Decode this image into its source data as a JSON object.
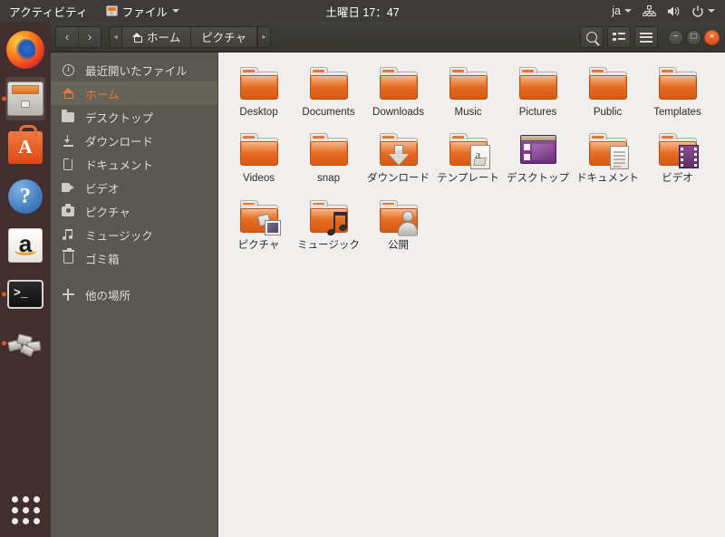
{
  "topbar": {
    "activities": "アクティビティ",
    "app_icon": "files-icon",
    "app_name": "ファイル",
    "app_caret": "chevron-down-icon",
    "clock": "土曜日 17：47",
    "language": "ja",
    "icons": [
      "network-icon",
      "volume-icon",
      "power-icon",
      "chevron-down-icon"
    ]
  },
  "launcher": {
    "items": [
      {
        "name": "firefox",
        "running": false,
        "focused": false
      },
      {
        "name": "files",
        "running": true,
        "focused": true
      },
      {
        "name": "ubuntu-software",
        "running": false,
        "focused": false
      },
      {
        "name": "help",
        "running": false,
        "focused": false
      },
      {
        "name": "amazon",
        "running": false,
        "focused": false
      },
      {
        "name": "terminal",
        "running": true,
        "focused": false
      },
      {
        "name": "misc-app",
        "running": true,
        "focused": false
      }
    ],
    "show_apps": "show-applications"
  },
  "window": {
    "nav": {
      "back": "‹",
      "forward": "›"
    },
    "pathbar": {
      "left_arrow": "◂",
      "right_arrow": "▸",
      "segments": [
        {
          "label": "ホーム",
          "icon": "home-icon",
          "active": false
        },
        {
          "label": "ピクチャ",
          "icon": "",
          "active": true
        }
      ]
    },
    "actions": [
      {
        "name": "search-button",
        "icon": "search-icon"
      },
      {
        "name": "view-toggle-button",
        "icon": "list-view-icon"
      },
      {
        "name": "menu-button",
        "icon": "hamburger-icon"
      }
    ],
    "controls": [
      {
        "name": "minimize-button",
        "glyph": "−"
      },
      {
        "name": "maximize-button",
        "glyph": "□"
      },
      {
        "name": "close-button",
        "glyph": "×"
      }
    ]
  },
  "sidebar": {
    "items": [
      {
        "label": "最近開いたファイル",
        "icon": "clock-icon",
        "selected": false
      },
      {
        "label": "ホーム",
        "icon": "home-icon",
        "selected": true
      },
      {
        "label": "デスクトップ",
        "icon": "folder-icon",
        "selected": false
      },
      {
        "label": "ダウンロード",
        "icon": "download-icon",
        "selected": false
      },
      {
        "label": "ドキュメント",
        "icon": "document-icon",
        "selected": false
      },
      {
        "label": "ビデオ",
        "icon": "video-icon",
        "selected": false
      },
      {
        "label": "ピクチャ",
        "icon": "camera-icon",
        "selected": false
      },
      {
        "label": "ミュージック",
        "icon": "music-icon",
        "selected": false
      },
      {
        "label": "ゴミ箱",
        "icon": "trash-icon",
        "selected": false
      }
    ],
    "other_locations": {
      "label": "他の場所",
      "icon": "plus-icon"
    }
  },
  "files": [
    {
      "label": "Desktop",
      "icon": "folder-plain"
    },
    {
      "label": "Documents",
      "icon": "folder-plain"
    },
    {
      "label": "Downloads",
      "icon": "folder-plain"
    },
    {
      "label": "Music",
      "icon": "folder-plain"
    },
    {
      "label": "Pictures",
      "icon": "folder-plain"
    },
    {
      "label": "Public",
      "icon": "folder-plain"
    },
    {
      "label": "Templates",
      "icon": "folder-plain"
    },
    {
      "label": "Videos",
      "icon": "folder-plain"
    },
    {
      "label": "snap",
      "icon": "folder-plain"
    },
    {
      "label": "ダウンロード",
      "icon": "folder-downloads"
    },
    {
      "label": "テンプレート",
      "icon": "folder-templates"
    },
    {
      "label": "デスクトップ",
      "icon": "window-purple"
    },
    {
      "label": "ドキュメント",
      "icon": "folder-documents"
    },
    {
      "label": "ビデオ",
      "icon": "folder-videos"
    },
    {
      "label": "ピクチャ",
      "icon": "folder-pictures"
    },
    {
      "label": "ミュージック",
      "icon": "folder-music"
    },
    {
      "label": "公開",
      "icon": "folder-public"
    }
  ],
  "colors": {
    "accent": "#e8772e",
    "topbar_bg": "#3c3b37",
    "launcher_bg": "#3c2727",
    "sidebar_bg": "#595750",
    "content_bg": "#f0efee",
    "close_button": "#e0521c"
  }
}
